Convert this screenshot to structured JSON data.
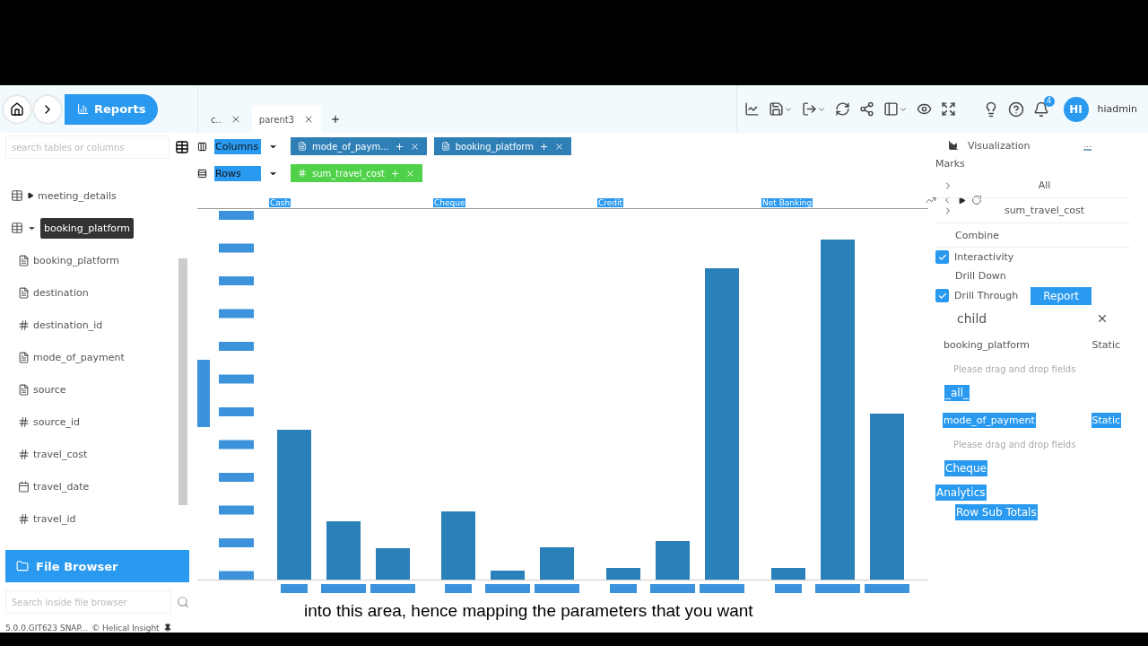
{
  "header": {
    "breadcrumb": "Reports"
  },
  "tabs": [
    {
      "label": "c..",
      "selected": false
    },
    {
      "label": "parent3",
      "selected": true
    }
  ],
  "toolbar": {
    "notifications": "4",
    "user_initials": "HI",
    "user_name": "hiadmin"
  },
  "sidebar": {
    "search_placeholder": "search tables or columns",
    "items": [
      {
        "label": "meeting_details",
        "kind": "table",
        "expanded": false
      },
      {
        "tooltip": "booking_platform",
        "kind": "table",
        "expanded": true,
        "children": [
          {
            "label": "booking_platform",
            "kind": "text"
          },
          {
            "label": "destination",
            "kind": "text"
          },
          {
            "label": "destination_id",
            "kind": "number"
          },
          {
            "label": "mode_of_payment",
            "kind": "text"
          },
          {
            "label": "source",
            "kind": "text"
          },
          {
            "label": "source_id",
            "kind": "number"
          },
          {
            "label": "travel_cost",
            "kind": "number"
          },
          {
            "label": "travel_date",
            "kind": "date"
          },
          {
            "label": "travel_id",
            "kind": "number"
          }
        ]
      }
    ],
    "file_browser": "File Browser",
    "file_search_placeholder": "Search inside file browser",
    "version": "5.0.0.GIT623 SNAP...",
    "brand": "© Helical Insight"
  },
  "shelves": [
    {
      "label": "Columns",
      "kind": "columns",
      "pills": [
        {
          "label": "mode_of_paym...",
          "kind": "text"
        },
        {
          "label": "booking_platform",
          "kind": "text"
        }
      ]
    },
    {
      "label": "Rows",
      "kind": "rows",
      "pills": [
        {
          "label": "sum_travel_cost",
          "kind": "measure"
        }
      ]
    }
  ],
  "chart": {
    "categories": [
      "Cash",
      "Cheque",
      "Credit",
      "Net Banking"
    ]
  },
  "panel": {
    "title": "Visualization",
    "more": "...",
    "marks_label": "Marks",
    "marks": [
      "All",
      "sum_travel_cost"
    ],
    "combine": "Combine",
    "options": [
      {
        "label": "Interactivity",
        "kind": "checkbox",
        "checked": true
      },
      {
        "label": "Drill Down",
        "kind": "plain"
      },
      {
        "label": "Drill Through",
        "kind": "checkbox",
        "checked": true,
        "button": "Report"
      }
    ],
    "report": "child",
    "fields": [
      {
        "field": "booking_platform",
        "mode": "Static",
        "highlighted": false,
        "placeholder": "Please drag and drop fields",
        "value": "_all_"
      },
      {
        "field": "mode_of_payment",
        "mode": "Static",
        "highlighted": true,
        "placeholder": "Please drag and drop fields",
        "value": "Cheque"
      }
    ],
    "analytics": "Analytics",
    "analytics_items": [
      "Row Sub Totals"
    ]
  },
  "caption": "into this area, hence mapping the parameters that you want"
}
